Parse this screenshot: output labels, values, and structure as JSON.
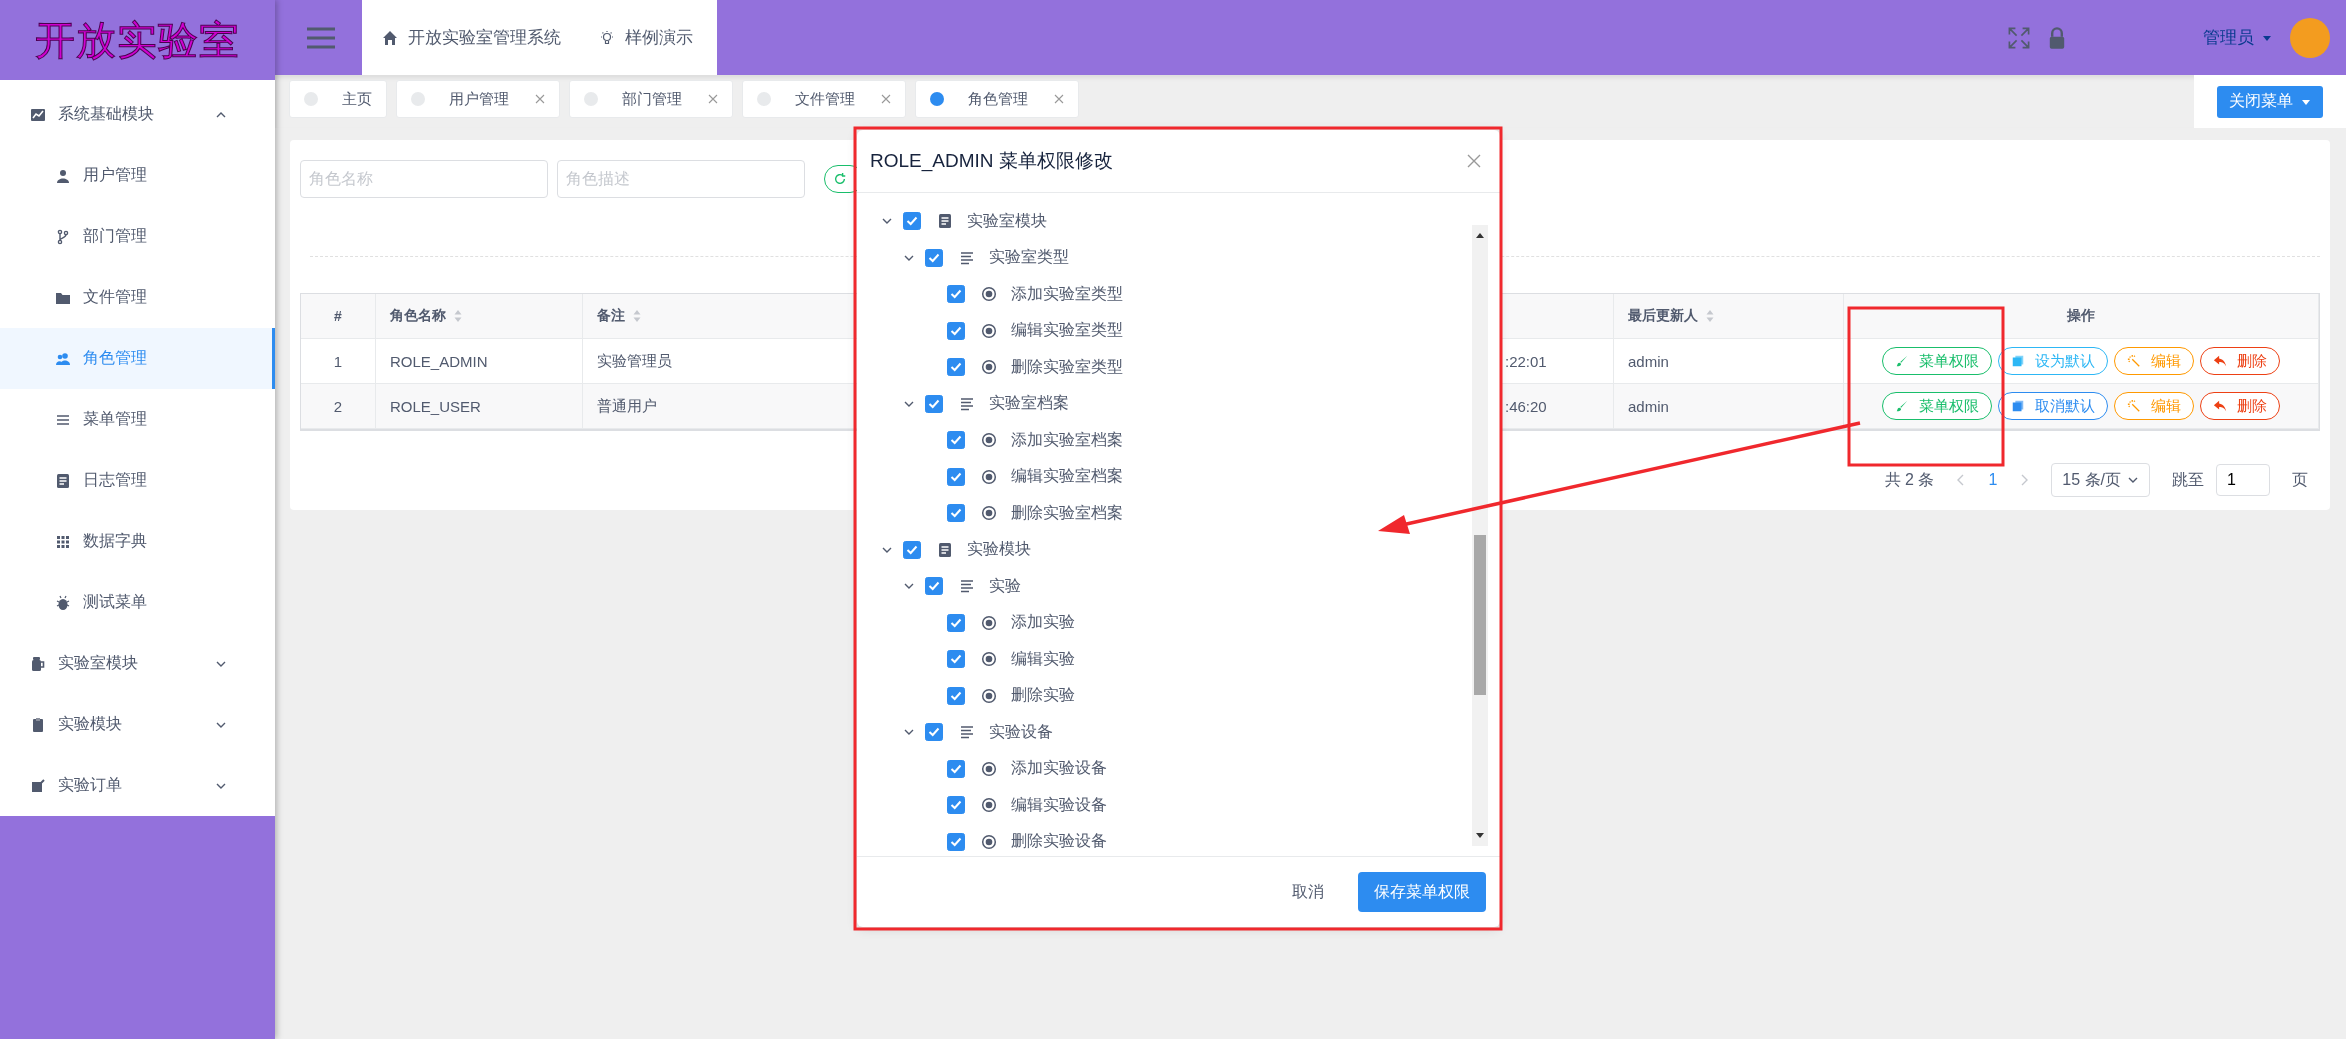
{
  "logo": {
    "title": "开放实验室"
  },
  "header": {
    "nav": [
      {
        "label": "开放实验室管理系统"
      },
      {
        "label": "样例演示"
      }
    ],
    "user": {
      "name": "管理员"
    }
  },
  "sidebar": {
    "items": [
      {
        "label": "系统基础模块",
        "expanded": true,
        "children": [
          {
            "label": "用户管理",
            "selected": false
          },
          {
            "label": "部门管理",
            "selected": false
          },
          {
            "label": "文件管理",
            "selected": false
          },
          {
            "label": "角色管理",
            "selected": true
          },
          {
            "label": "菜单管理",
            "selected": false
          },
          {
            "label": "日志管理",
            "selected": false
          },
          {
            "label": "数据字典",
            "selected": false
          },
          {
            "label": "测试菜单",
            "selected": false
          }
        ]
      },
      {
        "label": "实验室模块",
        "expanded": false
      },
      {
        "label": "实验模块",
        "expanded": false
      },
      {
        "label": "实验订单",
        "expanded": false
      }
    ]
  },
  "tabs": [
    {
      "label": "主页",
      "selected": false,
      "closable": false
    },
    {
      "label": "用户管理",
      "selected": false,
      "closable": true
    },
    {
      "label": "部门管理",
      "selected": false,
      "closable": true
    },
    {
      "label": "文件管理",
      "selected": false,
      "closable": true
    },
    {
      "label": "角色管理",
      "selected": true,
      "closable": true
    }
  ],
  "tabs_action": {
    "label": "关闭菜单"
  },
  "search": {
    "fields": [
      {
        "placeholder": "角色名称"
      },
      {
        "placeholder": "角色描述"
      }
    ]
  },
  "table": {
    "columns": [
      {
        "label": "#",
        "sortable": false
      },
      {
        "label": "角色名称",
        "sortable": true
      },
      {
        "label": "备注",
        "sortable": true
      },
      {
        "label": "最后更新人",
        "sortable": true
      },
      {
        "label": "操作",
        "sortable": false
      }
    ],
    "rows": [
      {
        "index": "1",
        "name": "ROLE_ADMIN",
        "remark": "实验管理员",
        "column_4": ":22:01",
        "updater": "admin",
        "actions": [
          {
            "label": "菜单权限",
            "kind": "permission"
          },
          {
            "label": "设为默认",
            "kind": "set-default"
          },
          {
            "label": "编辑",
            "kind": "edit"
          },
          {
            "label": "删除",
            "kind": "delete"
          }
        ]
      },
      {
        "index": "2",
        "name": "ROLE_USER",
        "remark": "普通用户",
        "column_4": ":46:20",
        "updater": "admin",
        "actions": [
          {
            "label": "菜单权限",
            "kind": "permission"
          },
          {
            "label": "取消默认",
            "kind": "unset-default"
          },
          {
            "label": "编辑",
            "kind": "edit"
          },
          {
            "label": "删除",
            "kind": "delete"
          }
        ]
      }
    ]
  },
  "pagination": {
    "total": "共 2 条",
    "page": "1",
    "page_size": "15 条/页",
    "jump_label": "跳至",
    "jump_value": "1",
    "page_suffix": "页"
  },
  "dialog": {
    "title": "ROLE_ADMIN 菜单权限修改",
    "tree": [
      {
        "label": "实验室模块",
        "kind": "module",
        "checked": true,
        "expanded": true,
        "children": [
          {
            "label": "实验室类型",
            "kind": "menu",
            "checked": true,
            "expanded": true,
            "children": [
              {
                "label": "添加实验室类型",
                "kind": "button",
                "checked": true
              },
              {
                "label": "编辑实验室类型",
                "kind": "button",
                "checked": true
              },
              {
                "label": "删除实验室类型",
                "kind": "button",
                "checked": true
              }
            ]
          },
          {
            "label": "实验室档案",
            "kind": "menu",
            "checked": true,
            "expanded": true,
            "children": [
              {
                "label": "添加实验室档案",
                "kind": "button",
                "checked": true
              },
              {
                "label": "编辑实验室档案",
                "kind": "button",
                "checked": true
              },
              {
                "label": "删除实验室档案",
                "kind": "button",
                "checked": true
              }
            ]
          }
        ]
      },
      {
        "label": "实验模块",
        "kind": "module",
        "checked": true,
        "expanded": true,
        "children": [
          {
            "label": "实验",
            "kind": "menu",
            "checked": true,
            "expanded": true,
            "children": [
              {
                "label": "添加实验",
                "kind": "button",
                "checked": true
              },
              {
                "label": "编辑实验",
                "kind": "button",
                "checked": true
              },
              {
                "label": "删除实验",
                "kind": "button",
                "checked": true
              }
            ]
          },
          {
            "label": "实验设备",
            "kind": "menu",
            "checked": true,
            "expanded": true,
            "children": [
              {
                "label": "添加实验设备",
                "kind": "button",
                "checked": true
              },
              {
                "label": "编辑实验设备",
                "kind": "button",
                "checked": true
              },
              {
                "label": "删除实验设备",
                "kind": "button",
                "checked": true
              }
            ]
          }
        ]
      }
    ],
    "buttons": [
      {
        "label": "取消",
        "kind": "text"
      },
      {
        "label": "保存菜单权限",
        "kind": "primary"
      }
    ]
  }
}
